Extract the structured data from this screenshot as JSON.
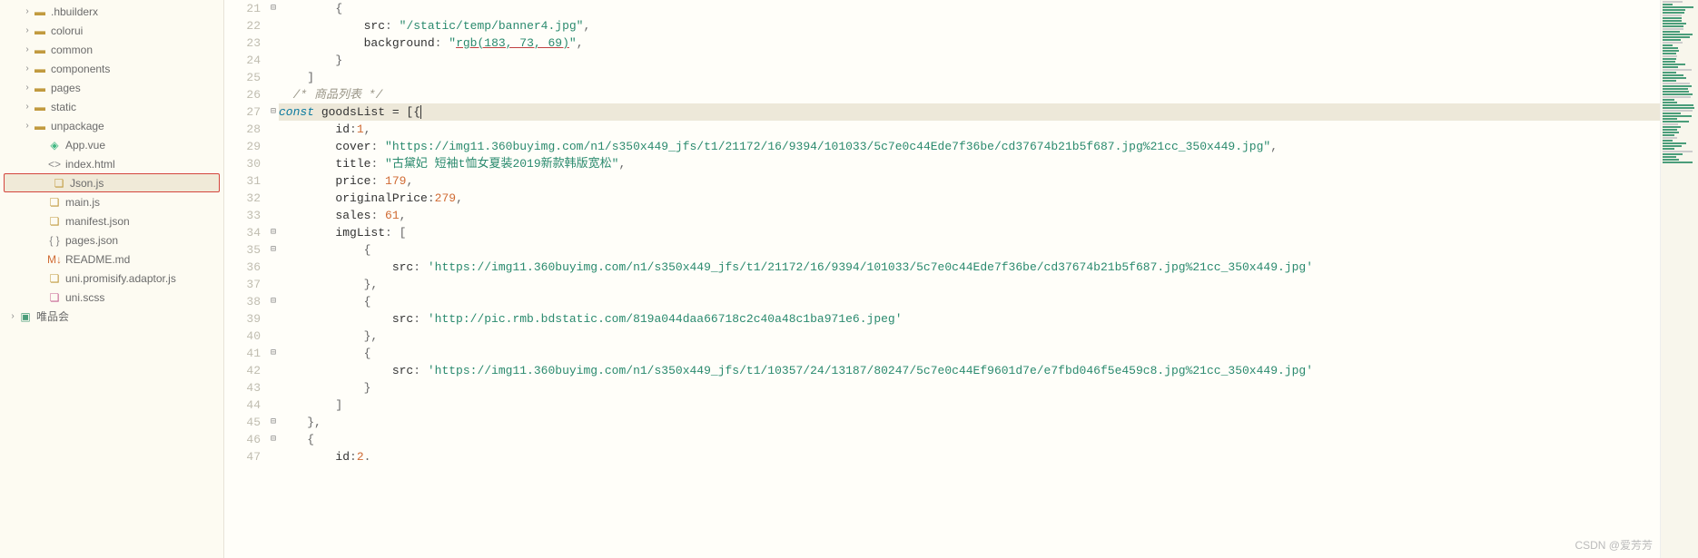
{
  "sidebar": {
    "items": [
      {
        "type": "folder",
        "label": ".hbuilderx",
        "indent": 1,
        "expandable": true,
        "expanded": false
      },
      {
        "type": "folder",
        "label": "colorui",
        "indent": 1,
        "expandable": true,
        "expanded": false
      },
      {
        "type": "folder",
        "label": "common",
        "indent": 1,
        "expandable": true,
        "expanded": false
      },
      {
        "type": "folder",
        "label": "components",
        "indent": 1,
        "expandable": true,
        "expanded": false
      },
      {
        "type": "folder",
        "label": "pages",
        "indent": 1,
        "expandable": true,
        "expanded": false
      },
      {
        "type": "folder",
        "label": "static",
        "indent": 1,
        "expandable": true,
        "expanded": false
      },
      {
        "type": "folder",
        "label": "unpackage",
        "indent": 1,
        "expandable": true,
        "expanded": false
      },
      {
        "type": "vue",
        "label": "App.vue",
        "indent": 2
      },
      {
        "type": "html",
        "label": "index.html",
        "indent": 2
      },
      {
        "type": "js",
        "label": "Json.js",
        "indent": 2,
        "highlighted": true
      },
      {
        "type": "js",
        "label": "main.js",
        "indent": 2
      },
      {
        "type": "json",
        "label": "manifest.json",
        "indent": 2
      },
      {
        "type": "json-brackets",
        "label": "pages.json",
        "indent": 2
      },
      {
        "type": "md",
        "label": "README.md",
        "indent": 2
      },
      {
        "type": "js",
        "label": "uni.promisify.adaptor.js",
        "indent": 2
      },
      {
        "type": "scss",
        "label": "uni.scss",
        "indent": 2
      },
      {
        "type": "project",
        "label": "唯品会",
        "indent": 0,
        "expandable": true,
        "expanded": false
      }
    ]
  },
  "code": {
    "startLine": 21,
    "currentLine": 27,
    "lines": [
      {
        "n": 21,
        "fold": "⊟",
        "segs": [
          {
            "t": "        {",
            "c": "punct"
          }
        ]
      },
      {
        "n": 22,
        "segs": [
          {
            "t": "            ",
            "c": ""
          },
          {
            "t": "src",
            "c": "prop"
          },
          {
            "t": ": ",
            "c": "punct"
          },
          {
            "t": "\"/static/temp/banner4.jpg\"",
            "c": "str"
          },
          {
            "t": ",",
            "c": "punct"
          }
        ]
      },
      {
        "n": 23,
        "segs": [
          {
            "t": "            ",
            "c": ""
          },
          {
            "t": "background",
            "c": "prop"
          },
          {
            "t": ": ",
            "c": "punct"
          },
          {
            "t": "\"",
            "c": "str"
          },
          {
            "t": "rgb(183, 73, 69)",
            "c": "str url-underline"
          },
          {
            "t": "\"",
            "c": "str"
          },
          {
            "t": ",",
            "c": "punct"
          }
        ]
      },
      {
        "n": 24,
        "segs": [
          {
            "t": "        }",
            "c": "punct"
          }
        ]
      },
      {
        "n": 25,
        "segs": [
          {
            "t": "    ]",
            "c": "punct"
          }
        ]
      },
      {
        "n": 26,
        "segs": [
          {
            "t": "  /* 商品列表 */",
            "c": "comment"
          }
        ]
      },
      {
        "n": 27,
        "fold": "⊟",
        "current": true,
        "segs": [
          {
            "t": "const",
            "c": "kw"
          },
          {
            "t": " goodsList = [{",
            "c": "prop"
          }
        ]
      },
      {
        "n": 28,
        "segs": [
          {
            "t": "        ",
            "c": ""
          },
          {
            "t": "id",
            "c": "prop"
          },
          {
            "t": ":",
            "c": "punct"
          },
          {
            "t": "1",
            "c": "num"
          },
          {
            "t": ",",
            "c": "punct"
          }
        ]
      },
      {
        "n": 29,
        "segs": [
          {
            "t": "        ",
            "c": ""
          },
          {
            "t": "cover",
            "c": "prop"
          },
          {
            "t": ": ",
            "c": "punct"
          },
          {
            "t": "\"https://img11.360buyimg.com/n1/s350x449_jfs/t1/21172/16/9394/101033/5c7e0c44Ede7f36be/cd37674b21b5f687.jpg%21cc_350x449.jpg\"",
            "c": "str"
          },
          {
            "t": ",",
            "c": "punct"
          }
        ]
      },
      {
        "n": 30,
        "segs": [
          {
            "t": "        ",
            "c": ""
          },
          {
            "t": "title",
            "c": "prop"
          },
          {
            "t": ": ",
            "c": "punct"
          },
          {
            "t": "\"古黛妃 短袖t恤女夏装2019新款韩版宽松\"",
            "c": "str"
          },
          {
            "t": ",",
            "c": "punct"
          }
        ]
      },
      {
        "n": 31,
        "segs": [
          {
            "t": "        ",
            "c": ""
          },
          {
            "t": "price",
            "c": "prop"
          },
          {
            "t": ": ",
            "c": "punct"
          },
          {
            "t": "179",
            "c": "num"
          },
          {
            "t": ",",
            "c": "punct"
          }
        ]
      },
      {
        "n": 32,
        "segs": [
          {
            "t": "        ",
            "c": ""
          },
          {
            "t": "originalPrice",
            "c": "prop"
          },
          {
            "t": ":",
            "c": "punct"
          },
          {
            "t": "279",
            "c": "num"
          },
          {
            "t": ",",
            "c": "punct"
          }
        ]
      },
      {
        "n": 33,
        "segs": [
          {
            "t": "        ",
            "c": ""
          },
          {
            "t": "sales",
            "c": "prop"
          },
          {
            "t": ": ",
            "c": "punct"
          },
          {
            "t": "61",
            "c": "num"
          },
          {
            "t": ",",
            "c": "punct"
          }
        ]
      },
      {
        "n": 34,
        "fold": "⊟",
        "segs": [
          {
            "t": "        ",
            "c": ""
          },
          {
            "t": "imgList",
            "c": "prop"
          },
          {
            "t": ": [",
            "c": "punct"
          }
        ]
      },
      {
        "n": 35,
        "fold": "⊟",
        "segs": [
          {
            "t": "            {",
            "c": "punct"
          }
        ]
      },
      {
        "n": 36,
        "segs": [
          {
            "t": "                ",
            "c": ""
          },
          {
            "t": "src",
            "c": "prop"
          },
          {
            "t": ": ",
            "c": "punct"
          },
          {
            "t": "'https://img11.360buyimg.com/n1/s350x449_jfs/t1/21172/16/9394/101033/5c7e0c44Ede7f36be/cd37674b21b5f687.jpg%21cc_350x449.jpg'",
            "c": "str"
          }
        ]
      },
      {
        "n": 37,
        "segs": [
          {
            "t": "            },",
            "c": "punct"
          }
        ]
      },
      {
        "n": 38,
        "fold": "⊟",
        "segs": [
          {
            "t": "            {",
            "c": "punct"
          }
        ]
      },
      {
        "n": 39,
        "segs": [
          {
            "t": "                ",
            "c": ""
          },
          {
            "t": "src",
            "c": "prop"
          },
          {
            "t": ": ",
            "c": "punct"
          },
          {
            "t": "'http://pic.rmb.bdstatic.com/819a044daa66718c2c40a48c1ba971e6.jpeg'",
            "c": "str"
          }
        ]
      },
      {
        "n": 40,
        "segs": [
          {
            "t": "            },",
            "c": "punct"
          }
        ]
      },
      {
        "n": 41,
        "fold": "⊟",
        "segs": [
          {
            "t": "            {",
            "c": "punct"
          }
        ]
      },
      {
        "n": 42,
        "segs": [
          {
            "t": "                ",
            "c": ""
          },
          {
            "t": "src",
            "c": "prop"
          },
          {
            "t": ": ",
            "c": "punct"
          },
          {
            "t": "'https://img11.360buyimg.com/n1/s350x449_jfs/t1/10357/24/13187/80247/5c7e0c44Ef9601d7e/e7fbd046f5e459c8.jpg%21cc_350x449.jpg'",
            "c": "str"
          }
        ]
      },
      {
        "n": 43,
        "segs": [
          {
            "t": "            }",
            "c": "punct"
          }
        ]
      },
      {
        "n": 44,
        "segs": [
          {
            "t": "        ]",
            "c": "punct"
          }
        ]
      },
      {
        "n": 45,
        "fold": "⊟",
        "segs": [
          {
            "t": "    },",
            "c": "punct"
          }
        ]
      },
      {
        "n": 46,
        "fold": "⊟",
        "segs": [
          {
            "t": "    {",
            "c": "punct"
          }
        ]
      },
      {
        "n": 47,
        "segs": [
          {
            "t": "        ",
            "c": ""
          },
          {
            "t": "id",
            "c": "prop"
          },
          {
            "t": ":",
            "c": "punct"
          },
          {
            "t": "2",
            "c": "num"
          },
          {
            "t": ".",
            "c": "punct"
          }
        ]
      }
    ]
  },
  "watermark": "CSDN @爱芳芳"
}
